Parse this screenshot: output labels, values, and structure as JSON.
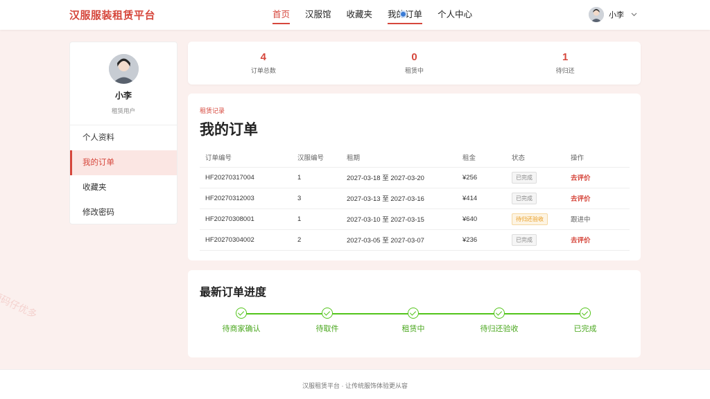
{
  "header": {
    "brand": "汉服服装租赁平台",
    "nav": [
      {
        "label": "首页",
        "active": true
      },
      {
        "label": "汉服馆"
      },
      {
        "label": "收藏夹"
      },
      {
        "label": "我的订单"
      },
      {
        "label": "个人中心"
      }
    ],
    "user_name": "小李"
  },
  "sidebar": {
    "name": "小李",
    "role": "租赁用户",
    "menu": [
      {
        "label": "个人资料"
      },
      {
        "label": "我的订单",
        "active": true
      },
      {
        "label": "收藏夹"
      },
      {
        "label": "修改密码"
      }
    ]
  },
  "stats": [
    {
      "value": "4",
      "label": "订单总数"
    },
    {
      "value": "0",
      "label": "租赁中"
    },
    {
      "value": "1",
      "label": "待归还"
    }
  ],
  "orders": {
    "kicker": "租赁记录",
    "title": "我的订单",
    "columns": [
      "订单编号",
      "汉服编号",
      "租期",
      "租金",
      "状态",
      "操作"
    ],
    "rows": [
      {
        "id": "HF20270317004",
        "item": "1",
        "period": "2027-03-18 至 2027-03-20",
        "rent": "¥256",
        "status": "已完成",
        "action": "去评价"
      },
      {
        "id": "HF20270312003",
        "item": "3",
        "period": "2027-03-13 至 2027-03-16",
        "rent": "¥414",
        "status": "已完成",
        "action": "去评价"
      },
      {
        "id": "HF20270308001",
        "item": "1",
        "period": "2027-03-10 至 2027-03-15",
        "rent": "¥640",
        "status": "待归还验收",
        "action": "跟进中"
      },
      {
        "id": "HF20270304002",
        "item": "2",
        "period": "2027-03-05 至 2027-03-07",
        "rent": "¥236",
        "status": "已完成",
        "action": "去评价"
      }
    ]
  },
  "progress": {
    "title": "最新订单进度",
    "steps": [
      "待商家确认",
      "待取件",
      "租赁中",
      "待归还验收",
      "已完成"
    ]
  },
  "footer": "汉服租赁平台 · 让传统服饰体验更从容",
  "watermark": "源码仔优多",
  "colors": {
    "accent": "#d6473c",
    "success": "#52c41a",
    "warning": "#e89a1c"
  }
}
